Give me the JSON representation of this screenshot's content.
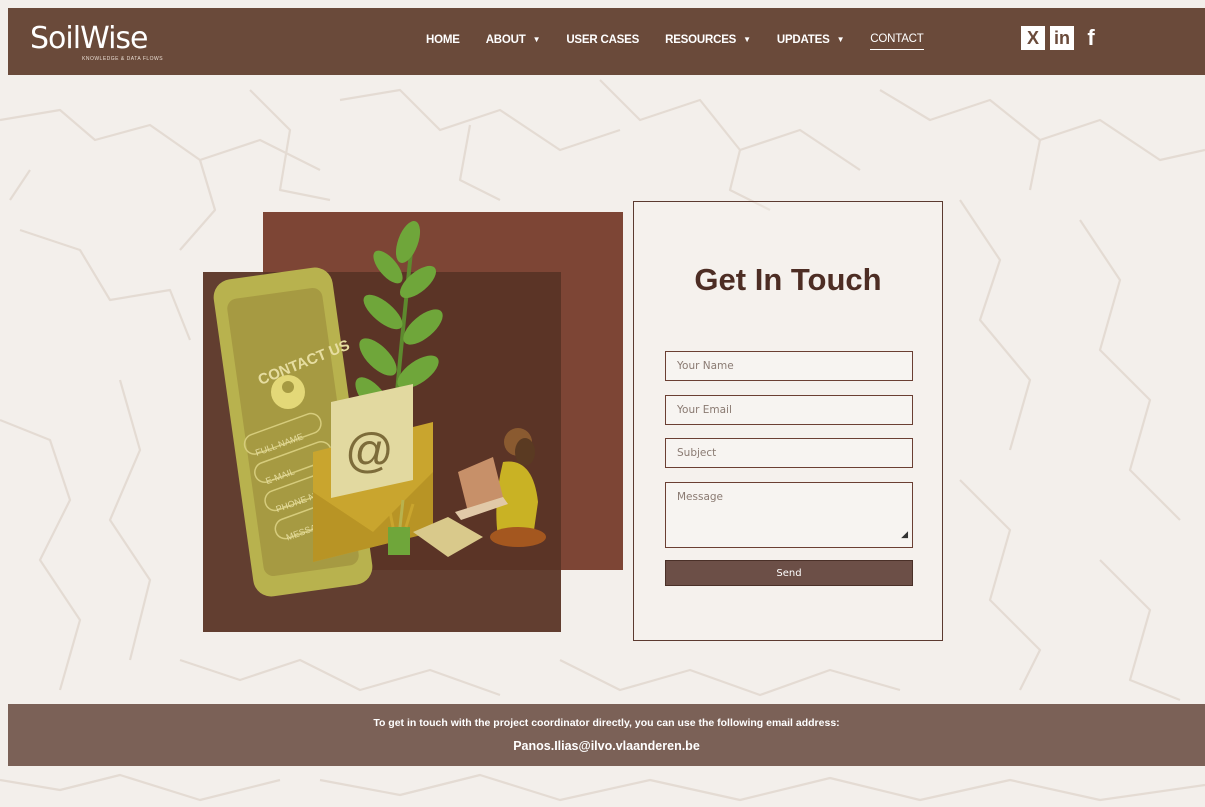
{
  "brand": {
    "name": "SoilWise",
    "tagline": "KNOWLEDGE & DATA FLOWS"
  },
  "nav": {
    "items": [
      {
        "label": "HOME",
        "dropdown": false
      },
      {
        "label": "ABOUT",
        "dropdown": true
      },
      {
        "label": "USER CASES",
        "dropdown": false
      },
      {
        "label": "RESOURCES",
        "dropdown": true
      },
      {
        "label": "UPDATES",
        "dropdown": true
      },
      {
        "label": "CONTACT",
        "dropdown": false,
        "active": true
      }
    ]
  },
  "social": [
    {
      "icon": "x-icon",
      "glyph": "X"
    },
    {
      "icon": "linkedin-icon",
      "glyph": "in"
    },
    {
      "icon": "facebook-icon",
      "glyph": "f"
    }
  ],
  "illustration": {
    "phone_heading": "CONTACT US",
    "phone_fields": [
      "FULL NAME",
      "E-MAIL",
      "PHONE N",
      "MESSAGE"
    ],
    "envelope_symbol": "@"
  },
  "form": {
    "title": "Get In Touch",
    "name_placeholder": "Your Name",
    "email_placeholder": "Your Email",
    "subject_placeholder": "Subject",
    "message_placeholder": "Message",
    "send_label": "Send"
  },
  "footer_band": {
    "text": "To get in touch with the project coordinator directly, you can use the following email address:",
    "email": "Panos.Ilias@ilvo.vlaanderen.be"
  },
  "colors": {
    "header_bg": "#6a4a3a",
    "accent_dark": "#4d2d24",
    "band_bg": "#7b6157",
    "page_bg": "#f3efeb"
  }
}
